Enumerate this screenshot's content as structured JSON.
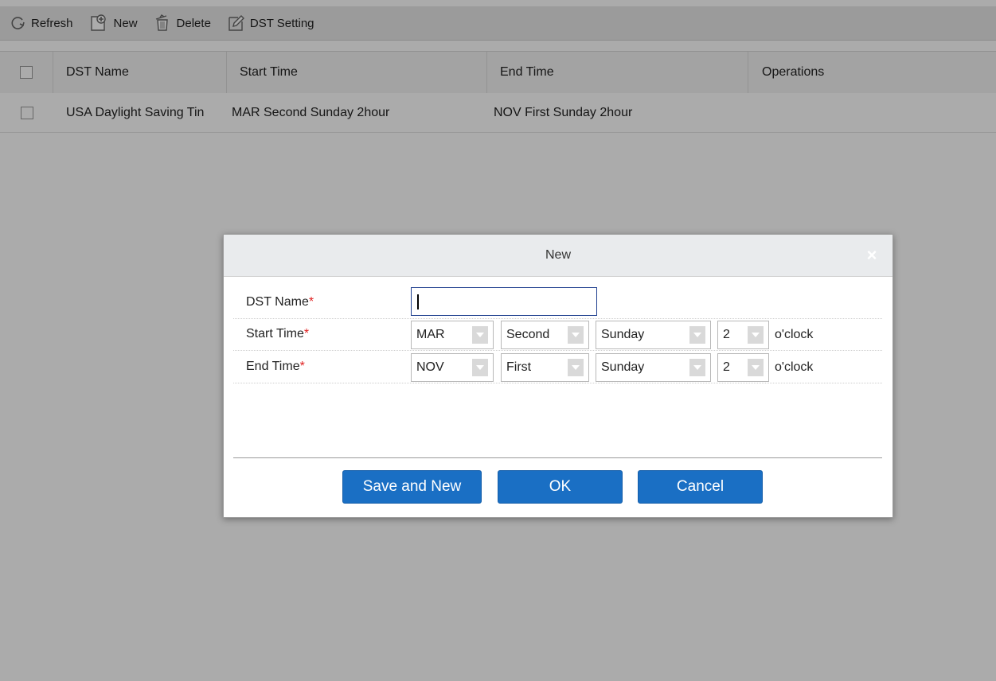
{
  "toolbar": {
    "refresh_label": "Refresh",
    "new_label": "New",
    "delete_label": "Delete",
    "dst_setting_label": "DST Setting"
  },
  "table": {
    "columns": [
      "DST Name",
      "Start Time",
      "End Time",
      "Operations"
    ],
    "rows": [
      {
        "dst_name": "USA Daylight Saving Tin",
        "start_time": "MAR Second Sunday 2hour",
        "end_time": "NOV First Sunday 2hour",
        "operations": ""
      }
    ]
  },
  "dialog": {
    "title": "New",
    "close_symbol": "×",
    "fields": {
      "name_label": "DST Name",
      "name_value": "",
      "start_label": "Start Time",
      "end_label": "End Time",
      "required_mark": "*"
    },
    "start": {
      "month": "MAR",
      "week": "Second",
      "day": "Sunday",
      "hour": "2",
      "unit": "o'clock"
    },
    "end": {
      "month": "NOV",
      "week": "First",
      "day": "Sunday",
      "hour": "2",
      "unit": "o'clock"
    },
    "buttons": {
      "save_new": "Save and New",
      "ok": "OK",
      "cancel": "Cancel"
    }
  },
  "colors": {
    "primary_button": "#1a6fc4",
    "required": "#e02020",
    "overlay": "rgba(0,0,0,0.33)"
  }
}
